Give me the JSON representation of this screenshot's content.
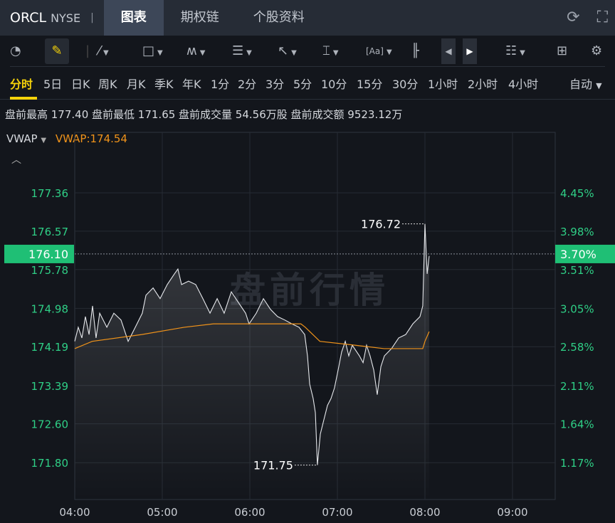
{
  "header": {
    "symbol": "ORCL",
    "exchange": "NYSE",
    "tabs": [
      "图表",
      "期权链",
      "个股资料"
    ],
    "active_tab": 0
  },
  "toolbar": {
    "icons": [
      "speedometer-icon",
      "pencil-icon",
      "line-tool-icon",
      "rectangle-tool-icon",
      "wave-tool-icon",
      "fib-tool-icon",
      "arrow-tool-icon",
      "measure-tool-icon",
      "text-tool-icon",
      "candlestick-icon",
      "prev-icon",
      "next-icon",
      "layout-list-icon",
      "grid-icon",
      "gear-icon"
    ]
  },
  "periods": {
    "items": [
      "分时",
      "5日",
      "日K",
      "周K",
      "月K",
      "季K",
      "年K",
      "1分",
      "2分",
      "3分",
      "5分",
      "10分",
      "15分",
      "30分",
      "1小时",
      "2小时",
      "4小时"
    ],
    "active": 0,
    "mode": "自动"
  },
  "stats": {
    "text": "盘前最高 177.40 盘前最低 171.65 盘前成交量 54.56万股 盘前成交额 9523.12万"
  },
  "indicator": {
    "name": "VWAP",
    "value": "VWAP:174.54"
  },
  "watermark": "盘前行情",
  "colors": {
    "up": "#2fcf86",
    "vwap": "#f0931a",
    "active": "#f5d20a"
  },
  "chart_data": {
    "type": "line",
    "x_ticks": [
      "04:00",
      "05:00",
      "06:00",
      "07:00",
      "08:00",
      "09:00"
    ],
    "x_range_minutes": [
      0,
      329
    ],
    "y_ticks": [
      "177.36",
      "176.57",
      "175.78",
      "174.98",
      "174.19",
      "173.39",
      "172.60",
      "171.80"
    ],
    "y_tick_values": [
      177.36,
      176.57,
      175.78,
      174.98,
      174.19,
      173.39,
      172.6,
      171.8
    ],
    "pct_ticks": [
      "4.45%",
      "3.98%",
      "3.51%",
      "3.05%",
      "2.58%",
      "2.11%",
      "1.64%",
      "1.17%"
    ],
    "current_price": "176.10",
    "current_pct": "3.70%",
    "current_value": 176.1,
    "high_label": "176.72",
    "low_label": "171.75",
    "price": [
      [
        0,
        174.3
      ],
      [
        2.4,
        174.59
      ],
      [
        4.9,
        174.37
      ],
      [
        7.3,
        174.81
      ],
      [
        9.8,
        174.44
      ],
      [
        12.2,
        175.03
      ],
      [
        14.6,
        174.37
      ],
      [
        17.1,
        174.88
      ],
      [
        22,
        174.59
      ],
      [
        26.8,
        174.88
      ],
      [
        31.7,
        174.74
      ],
      [
        36.6,
        174.3
      ],
      [
        41.5,
        174.59
      ],
      [
        46.3,
        174.88
      ],
      [
        48.8,
        175.25
      ],
      [
        53.7,
        175.4
      ],
      [
        58.5,
        175.18
      ],
      [
        63.4,
        175.47
      ],
      [
        68.3,
        175.69
      ],
      [
        70.7,
        175.79
      ],
      [
        73.2,
        175.47
      ],
      [
        78,
        175.54
      ],
      [
        82.9,
        175.47
      ],
      [
        87.8,
        175.18
      ],
      [
        92.7,
        174.88
      ],
      [
        97.6,
        175.18
      ],
      [
        102.4,
        174.88
      ],
      [
        107.3,
        175.32
      ],
      [
        112.2,
        175.1
      ],
      [
        117.1,
        174.88
      ],
      [
        119.5,
        174.66
      ],
      [
        124.4,
        174.88
      ],
      [
        129.3,
        175.18
      ],
      [
        134.1,
        174.96
      ],
      [
        139,
        174.81
      ],
      [
        143.9,
        174.74
      ],
      [
        148.8,
        174.66
      ],
      [
        153.7,
        174.59
      ],
      [
        157.6,
        174.44
      ],
      [
        159.5,
        174.0
      ],
      [
        161,
        173.42
      ],
      [
        163.4,
        173.12
      ],
      [
        164.9,
        172.83
      ],
      [
        166.3,
        171.75
      ],
      [
        168.3,
        172.39
      ],
      [
        170.7,
        172.68
      ],
      [
        173.2,
        172.98
      ],
      [
        175.6,
        173.12
      ],
      [
        178,
        173.34
      ],
      [
        180.5,
        173.71
      ],
      [
        182.9,
        174.08
      ],
      [
        185.4,
        174.3
      ],
      [
        187.8,
        174.0
      ],
      [
        190.2,
        174.22
      ],
      [
        195.1,
        174.0
      ],
      [
        197.6,
        173.86
      ],
      [
        200,
        174.22
      ],
      [
        202.4,
        174.0
      ],
      [
        204.9,
        173.71
      ],
      [
        207.3,
        173.2
      ],
      [
        209.8,
        173.78
      ],
      [
        212.2,
        174.0
      ],
      [
        217.1,
        174.15
      ],
      [
        222,
        174.37
      ],
      [
        226.8,
        174.44
      ],
      [
        231.7,
        174.66
      ],
      [
        236.6,
        174.81
      ],
      [
        238.5,
        175.03
      ],
      [
        240,
        176.72
      ],
      [
        241.5,
        175.69
      ],
      [
        242.9,
        176.06
      ]
    ],
    "vwap": [
      [
        0,
        174.15
      ],
      [
        12,
        174.3
      ],
      [
        46,
        174.44
      ],
      [
        75,
        174.59
      ],
      [
        95,
        174.66
      ],
      [
        155,
        174.66
      ],
      [
        158,
        174.59
      ],
      [
        168,
        174.3
      ],
      [
        192,
        174.22
      ],
      [
        212,
        174.15
      ],
      [
        238.5,
        174.15
      ],
      [
        240,
        174.3
      ],
      [
        242.9,
        174.5
      ]
    ]
  }
}
